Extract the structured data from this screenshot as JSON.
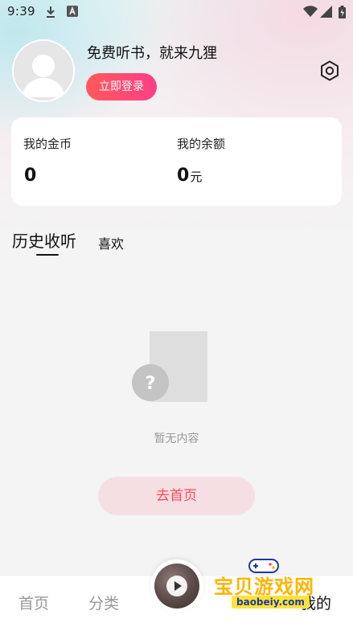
{
  "status_bar": {
    "time": "9:39",
    "icons": [
      "download-icon",
      "a-icon",
      "wifi-icon",
      "signal-icon",
      "battery-icon"
    ]
  },
  "profile": {
    "slogan": "免费听书，就来九狸",
    "login_label": "立即登录",
    "settings_icon": "gear-icon"
  },
  "wallet": {
    "coins_label": "我的金币",
    "coins_value": "0",
    "balance_label": "我的余额",
    "balance_value": "0",
    "balance_unit": "元"
  },
  "tabs": {
    "history": "历史收听",
    "likes": "喜欢",
    "active": "history"
  },
  "empty_state": {
    "message": "暂无内容",
    "button_label": "去首页"
  },
  "bottom_nav": {
    "home": "首页",
    "category": "分类",
    "mine": "我的",
    "active": "mine"
  },
  "watermark": {
    "title": "宝贝游戏网",
    "url": "baobeiy.com"
  },
  "colors": {
    "accent_gradient_start": "#ff5a5a",
    "accent_gradient_end": "#ff3e86",
    "home_button_bg": "#f6dfe3",
    "home_button_text": "#ff4a57",
    "muted_text": "#9a9a9a"
  }
}
